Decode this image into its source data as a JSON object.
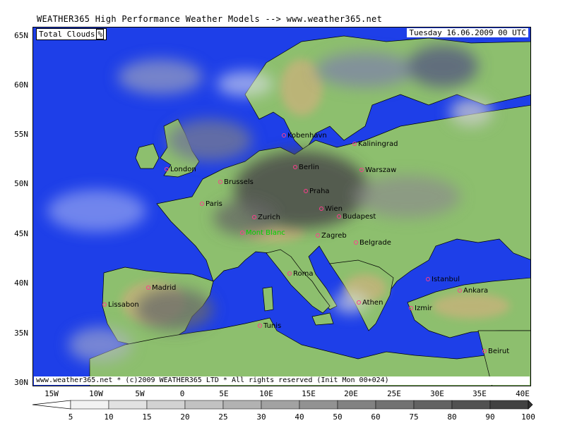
{
  "header": {
    "title": "WEATHER365 High Performance Weather Models --> www.weather365.net"
  },
  "map": {
    "parameter": "Total Clouds",
    "unit": "%",
    "valid_time": "Tuesday 16.06.2009 00 UTC",
    "footer": "www.weather365.net  * (c)2009 WEATHER365 LTD * All rights reserved (Init Mon 00+024)",
    "lat_labels": [
      "65N",
      "60N",
      "55N",
      "50N",
      "45N",
      "40N",
      "35N",
      "30N"
    ],
    "lon_labels": [
      "15W",
      "10W",
      "5W",
      "0",
      "5E",
      "10E",
      "15E",
      "20E",
      "25E",
      "30E",
      "35E",
      "40E"
    ],
    "cities": [
      {
        "name": "Kobenhavn",
        "peak": false
      },
      {
        "name": "Kaliningrad",
        "peak": false
      },
      {
        "name": "London",
        "peak": false
      },
      {
        "name": "Berlin",
        "peak": false
      },
      {
        "name": "Warszaw",
        "peak": false
      },
      {
        "name": "Brussels",
        "peak": false
      },
      {
        "name": "Praha",
        "peak": false
      },
      {
        "name": "Paris",
        "peak": false
      },
      {
        "name": "Wien",
        "peak": false
      },
      {
        "name": "Budapest",
        "peak": false
      },
      {
        "name": "Zurich",
        "peak": false
      },
      {
        "name": "Mont Blanc",
        "peak": true
      },
      {
        "name": "Zagreb",
        "peak": false
      },
      {
        "name": "Belgrade",
        "peak": false
      },
      {
        "name": "Roma",
        "peak": false
      },
      {
        "name": "Istanbul",
        "peak": false
      },
      {
        "name": "Madrid",
        "peak": false
      },
      {
        "name": "Ankara",
        "peak": false
      },
      {
        "name": "Lissabon",
        "peak": false
      },
      {
        "name": "Athen",
        "peak": false
      },
      {
        "name": "Izmir",
        "peak": false
      },
      {
        "name": "Tunis",
        "peak": false
      },
      {
        "name": "Beirut",
        "peak": false
      }
    ],
    "colors": {
      "sea": "#1e3fe8",
      "land": "#8dbf6e",
      "highland": "#c7b27a",
      "marker": "#ff3c8c",
      "peak_label": "#00d400"
    }
  },
  "scale": {
    "values": [
      "5",
      "10",
      "15",
      "20",
      "25",
      "30",
      "40",
      "50",
      "60",
      "75",
      "80",
      "90",
      "100"
    ],
    "colors": [
      "#ffffff",
      "#f2f2f2",
      "#e2e2e2",
      "#d2d2d2",
      "#c2c2c2",
      "#b2b2b2",
      "#a2a2a2",
      "#929292",
      "#828282",
      "#727272",
      "#626262",
      "#525252",
      "#424242",
      "#333333"
    ]
  }
}
